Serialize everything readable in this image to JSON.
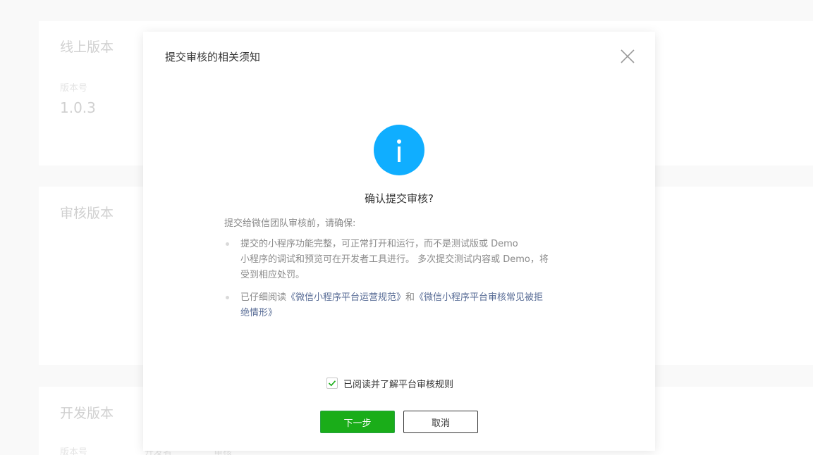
{
  "background": {
    "online_version": {
      "title": "线上版本",
      "version_label": "版本号",
      "version_value": "1.0.3"
    },
    "review_version": {
      "title": "审核版本"
    },
    "dev_version": {
      "title": "开发版本",
      "fields": [
        "版本号",
        "开发者",
        "审核"
      ]
    }
  },
  "dialog": {
    "title": "提交审核的相关须知",
    "icon": "info-icon",
    "heading": "确认提交审核?",
    "intro": "提交给微信团队审核前，请确保:",
    "rules": {
      "rule1_line1": "提交的小程序功能完整，可正常打开和运行，而不是测试版或 Demo",
      "rule1_line2": "小程序的调试和预览可在开发者工具进行。 多次提交测试内容或 Demo，将",
      "rule1_line3": "受到相应处罚。",
      "rule2_prefix": "已仔细阅读",
      "rule2_link1": "《微信小程序平台运营规范》",
      "rule2_and": "和",
      "rule2_link2_line1": "《微信小程序平台审核常见被拒",
      "rule2_link2_line2": "绝情形》"
    },
    "agree_label": "已阅读并了解平台审核规则",
    "agree_checked": true,
    "next_button": "下一步",
    "cancel_button": "取消"
  },
  "colors": {
    "primary_green": "#1aad19",
    "info_blue": "#10aeff",
    "link_blue": "#576b95"
  }
}
